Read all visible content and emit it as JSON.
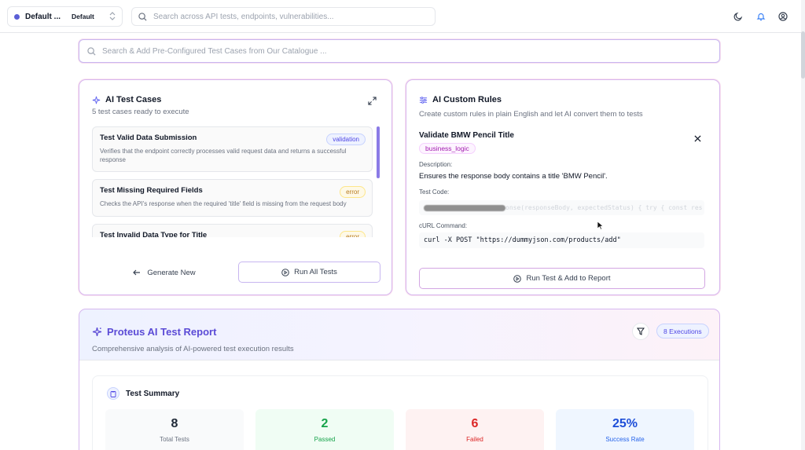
{
  "topbar": {
    "workspace_name": "Default ...",
    "environment": "Default",
    "search_placeholder": "Search across API tests, endpoints, vulnerabilities..."
  },
  "catalog": {
    "search_placeholder": "Search & Add Pre-Configured Test Cases from Our Catalogue ..."
  },
  "ai_tests": {
    "title": "AI Test Cases",
    "subtitle": "5 test cases ready to execute",
    "items": [
      {
        "title": "Test Valid Data Submission",
        "badge": "validation",
        "desc": "Verifies that the endpoint correctly processes valid request data and returns a successful response"
      },
      {
        "title": "Test Missing Required Fields",
        "badge": "error",
        "desc": "Checks the API's response when the required 'title' field is missing from the request body"
      },
      {
        "title": "Test Invalid Data Type for Title",
        "badge": "error",
        "desc": ""
      }
    ],
    "generate_label": "Generate New",
    "run_all_label": "Run All Tests"
  },
  "custom_rules": {
    "title": "AI Custom Rules",
    "subtitle": "Create custom rules in plain English and let AI convert them to tests",
    "rule_name": "Validate BMW Pencil Title",
    "rule_tag": "business_logic",
    "description_label": "Description:",
    "description": "Ensures the response body contains a title 'BMW Pencil'.",
    "code_label": "Test Code:",
    "code_snippet": "onse(responseBody, expectedStatus) { try { const res",
    "curl_label": "cURL Command:",
    "curl": "curl -X POST \"https://dummyjson.com/products/add\"",
    "run_label": "Run Test & Add to Report"
  },
  "report": {
    "title": "Proteus AI Test Report",
    "subtitle": "Comprehensive analysis of AI-powered test execution results",
    "executions": "8 Executions",
    "summary_title": "Test Summary",
    "stats": [
      {
        "value": "8",
        "label": "Total Tests"
      },
      {
        "value": "2",
        "label": "Passed"
      },
      {
        "value": "6",
        "label": "Failed"
      },
      {
        "value": "25%",
        "label": "Success Rate"
      }
    ]
  },
  "colors": {
    "accent": "#5b5fd6",
    "border_gradient": "#d6b7ef",
    "passed": "#16a34a",
    "failed": "#dc2626",
    "rate": "#1d4ed8"
  },
  "icons": [
    "search-icon",
    "moon-icon",
    "bell-icon",
    "user-circle-icon",
    "sparkles-icon",
    "expand-icon",
    "sliders-icon",
    "close-icon",
    "arrow-left-icon",
    "play-circle-icon",
    "filter-icon",
    "clipboard-icon"
  ]
}
